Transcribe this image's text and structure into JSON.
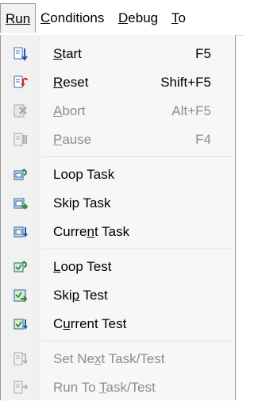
{
  "menubar": {
    "items": [
      {
        "label": "Run",
        "active": true
      },
      {
        "label": "Conditions"
      },
      {
        "label": "Debug"
      },
      {
        "label": "To"
      }
    ]
  },
  "menu": {
    "items": [
      {
        "label_pre": "",
        "label_acc": "S",
        "label_post": "tart",
        "shortcut": "F5",
        "icon": "start-icon",
        "enabled": true
      },
      {
        "label_pre": "",
        "label_acc": "R",
        "label_post": "eset",
        "shortcut": "Shift+F5",
        "icon": "reset-icon",
        "enabled": true
      },
      {
        "label_pre": "",
        "label_acc": "A",
        "label_post": "bort",
        "shortcut": "Alt+F5",
        "icon": "abort-icon",
        "enabled": false
      },
      {
        "label_pre": "",
        "label_acc": "P",
        "label_post": "ause",
        "shortcut": "F4",
        "icon": "pause-icon",
        "enabled": false
      },
      {
        "label_pre": "",
        "label_acc": "",
        "label_post": "Loop Task",
        "shortcut": "",
        "icon": "loop-task-icon",
        "enabled": true
      },
      {
        "label_pre": "Skip Task",
        "label_acc": "",
        "label_post": "",
        "shortcut": "",
        "icon": "skip-task-icon",
        "enabled": true
      },
      {
        "label_pre": "Curre",
        "label_acc": "n",
        "label_post": "t Task",
        "shortcut": "",
        "icon": "current-task-icon",
        "enabled": true
      },
      {
        "label_pre": "",
        "label_acc": "L",
        "label_post": "oop Test",
        "shortcut": "",
        "icon": "loop-test-icon",
        "enabled": true
      },
      {
        "label_pre": "Ski",
        "label_acc": "p",
        "label_post": " Test",
        "shortcut": "",
        "icon": "skip-test-icon",
        "enabled": true
      },
      {
        "label_pre": "C",
        "label_acc": "u",
        "label_post": "rrent Test",
        "shortcut": "",
        "icon": "current-test-icon",
        "enabled": true
      },
      {
        "label_pre": "Set Ne",
        "label_acc": "x",
        "label_post": "t Task/Test",
        "shortcut": "",
        "icon": "set-next-icon",
        "enabled": false
      },
      {
        "label_pre": "Run To ",
        "label_acc": "T",
        "label_post": "ask/Test",
        "shortcut": "",
        "icon": "run-to-icon",
        "enabled": false
      }
    ]
  }
}
